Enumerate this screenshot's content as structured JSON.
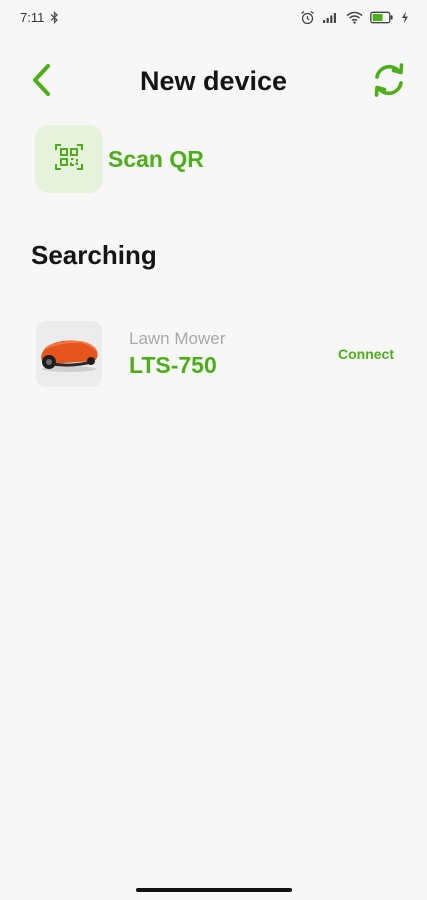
{
  "status_bar": {
    "time": "7:11",
    "icons": [
      "bluetooth-icon",
      "alarm-icon",
      "signal-icon",
      "wifi-icon",
      "battery-icon",
      "charging-icon"
    ]
  },
  "header": {
    "title": "New device",
    "back_icon": "chevron-left-icon",
    "refresh_icon": "refresh-icon"
  },
  "scan_qr": {
    "label": "Scan QR",
    "icon": "qr-scan-icon"
  },
  "section": {
    "title": "Searching"
  },
  "devices": [
    {
      "type": "Lawn Mower",
      "model": "LTS-750",
      "action_label": "Connect",
      "image": "robot-lawn-mower"
    }
  ],
  "colors": {
    "accent": "#4caf1a",
    "background": "#f7f7f7",
    "scan_tile": "#e6f2dc",
    "mower_body": "#e8541e"
  }
}
